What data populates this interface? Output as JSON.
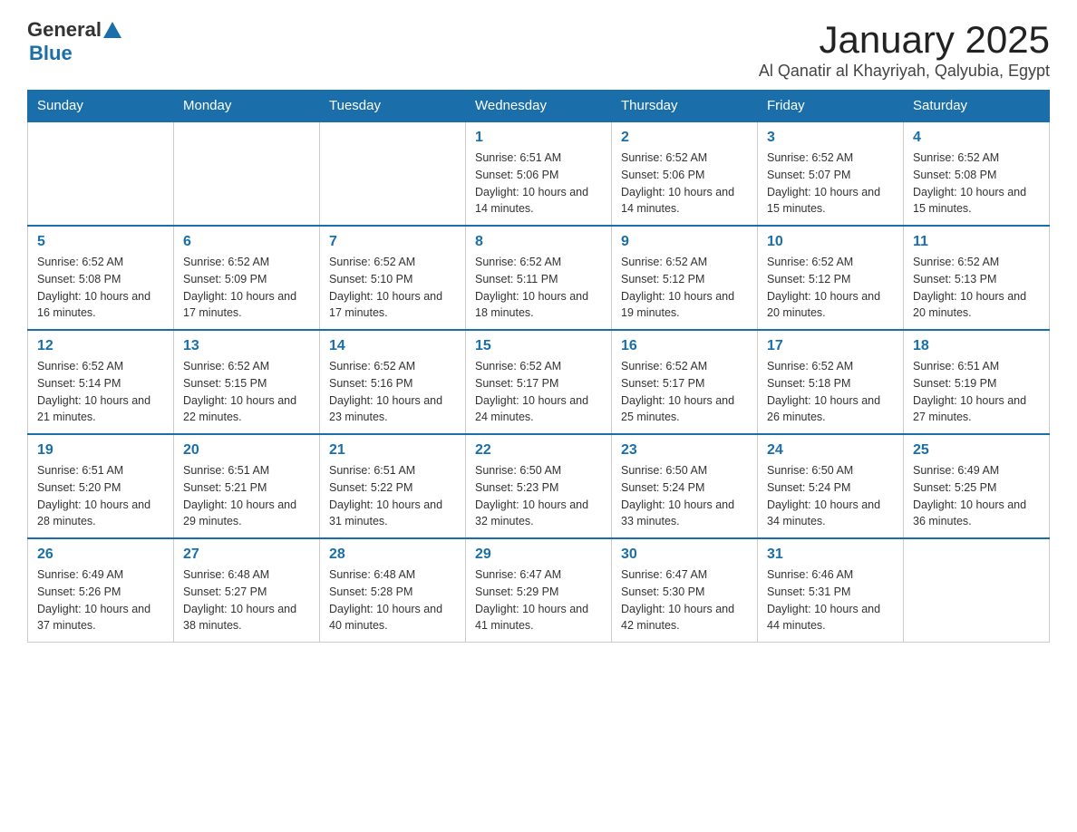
{
  "header": {
    "logo_general": "General",
    "logo_blue": "Blue",
    "month_title": "January 2025",
    "location": "Al Qanatir al Khayriyah, Qalyubia, Egypt"
  },
  "weekdays": [
    "Sunday",
    "Monday",
    "Tuesday",
    "Wednesday",
    "Thursday",
    "Friday",
    "Saturday"
  ],
  "weeks": [
    [
      {
        "day": "",
        "sunrise": "",
        "sunset": "",
        "daylight": ""
      },
      {
        "day": "",
        "sunrise": "",
        "sunset": "",
        "daylight": ""
      },
      {
        "day": "",
        "sunrise": "",
        "sunset": "",
        "daylight": ""
      },
      {
        "day": "1",
        "sunrise": "Sunrise: 6:51 AM",
        "sunset": "Sunset: 5:06 PM",
        "daylight": "Daylight: 10 hours and 14 minutes."
      },
      {
        "day": "2",
        "sunrise": "Sunrise: 6:52 AM",
        "sunset": "Sunset: 5:06 PM",
        "daylight": "Daylight: 10 hours and 14 minutes."
      },
      {
        "day": "3",
        "sunrise": "Sunrise: 6:52 AM",
        "sunset": "Sunset: 5:07 PM",
        "daylight": "Daylight: 10 hours and 15 minutes."
      },
      {
        "day": "4",
        "sunrise": "Sunrise: 6:52 AM",
        "sunset": "Sunset: 5:08 PM",
        "daylight": "Daylight: 10 hours and 15 minutes."
      }
    ],
    [
      {
        "day": "5",
        "sunrise": "Sunrise: 6:52 AM",
        "sunset": "Sunset: 5:08 PM",
        "daylight": "Daylight: 10 hours and 16 minutes."
      },
      {
        "day": "6",
        "sunrise": "Sunrise: 6:52 AM",
        "sunset": "Sunset: 5:09 PM",
        "daylight": "Daylight: 10 hours and 17 minutes."
      },
      {
        "day": "7",
        "sunrise": "Sunrise: 6:52 AM",
        "sunset": "Sunset: 5:10 PM",
        "daylight": "Daylight: 10 hours and 17 minutes."
      },
      {
        "day": "8",
        "sunrise": "Sunrise: 6:52 AM",
        "sunset": "Sunset: 5:11 PM",
        "daylight": "Daylight: 10 hours and 18 minutes."
      },
      {
        "day": "9",
        "sunrise": "Sunrise: 6:52 AM",
        "sunset": "Sunset: 5:12 PM",
        "daylight": "Daylight: 10 hours and 19 minutes."
      },
      {
        "day": "10",
        "sunrise": "Sunrise: 6:52 AM",
        "sunset": "Sunset: 5:12 PM",
        "daylight": "Daylight: 10 hours and 20 minutes."
      },
      {
        "day": "11",
        "sunrise": "Sunrise: 6:52 AM",
        "sunset": "Sunset: 5:13 PM",
        "daylight": "Daylight: 10 hours and 20 minutes."
      }
    ],
    [
      {
        "day": "12",
        "sunrise": "Sunrise: 6:52 AM",
        "sunset": "Sunset: 5:14 PM",
        "daylight": "Daylight: 10 hours and 21 minutes."
      },
      {
        "day": "13",
        "sunrise": "Sunrise: 6:52 AM",
        "sunset": "Sunset: 5:15 PM",
        "daylight": "Daylight: 10 hours and 22 minutes."
      },
      {
        "day": "14",
        "sunrise": "Sunrise: 6:52 AM",
        "sunset": "Sunset: 5:16 PM",
        "daylight": "Daylight: 10 hours and 23 minutes."
      },
      {
        "day": "15",
        "sunrise": "Sunrise: 6:52 AM",
        "sunset": "Sunset: 5:17 PM",
        "daylight": "Daylight: 10 hours and 24 minutes."
      },
      {
        "day": "16",
        "sunrise": "Sunrise: 6:52 AM",
        "sunset": "Sunset: 5:17 PM",
        "daylight": "Daylight: 10 hours and 25 minutes."
      },
      {
        "day": "17",
        "sunrise": "Sunrise: 6:52 AM",
        "sunset": "Sunset: 5:18 PM",
        "daylight": "Daylight: 10 hours and 26 minutes."
      },
      {
        "day": "18",
        "sunrise": "Sunrise: 6:51 AM",
        "sunset": "Sunset: 5:19 PM",
        "daylight": "Daylight: 10 hours and 27 minutes."
      }
    ],
    [
      {
        "day": "19",
        "sunrise": "Sunrise: 6:51 AM",
        "sunset": "Sunset: 5:20 PM",
        "daylight": "Daylight: 10 hours and 28 minutes."
      },
      {
        "day": "20",
        "sunrise": "Sunrise: 6:51 AM",
        "sunset": "Sunset: 5:21 PM",
        "daylight": "Daylight: 10 hours and 29 minutes."
      },
      {
        "day": "21",
        "sunrise": "Sunrise: 6:51 AM",
        "sunset": "Sunset: 5:22 PM",
        "daylight": "Daylight: 10 hours and 31 minutes."
      },
      {
        "day": "22",
        "sunrise": "Sunrise: 6:50 AM",
        "sunset": "Sunset: 5:23 PM",
        "daylight": "Daylight: 10 hours and 32 minutes."
      },
      {
        "day": "23",
        "sunrise": "Sunrise: 6:50 AM",
        "sunset": "Sunset: 5:24 PM",
        "daylight": "Daylight: 10 hours and 33 minutes."
      },
      {
        "day": "24",
        "sunrise": "Sunrise: 6:50 AM",
        "sunset": "Sunset: 5:24 PM",
        "daylight": "Daylight: 10 hours and 34 minutes."
      },
      {
        "day": "25",
        "sunrise": "Sunrise: 6:49 AM",
        "sunset": "Sunset: 5:25 PM",
        "daylight": "Daylight: 10 hours and 36 minutes."
      }
    ],
    [
      {
        "day": "26",
        "sunrise": "Sunrise: 6:49 AM",
        "sunset": "Sunset: 5:26 PM",
        "daylight": "Daylight: 10 hours and 37 minutes."
      },
      {
        "day": "27",
        "sunrise": "Sunrise: 6:48 AM",
        "sunset": "Sunset: 5:27 PM",
        "daylight": "Daylight: 10 hours and 38 minutes."
      },
      {
        "day": "28",
        "sunrise": "Sunrise: 6:48 AM",
        "sunset": "Sunset: 5:28 PM",
        "daylight": "Daylight: 10 hours and 40 minutes."
      },
      {
        "day": "29",
        "sunrise": "Sunrise: 6:47 AM",
        "sunset": "Sunset: 5:29 PM",
        "daylight": "Daylight: 10 hours and 41 minutes."
      },
      {
        "day": "30",
        "sunrise": "Sunrise: 6:47 AM",
        "sunset": "Sunset: 5:30 PM",
        "daylight": "Daylight: 10 hours and 42 minutes."
      },
      {
        "day": "31",
        "sunrise": "Sunrise: 6:46 AM",
        "sunset": "Sunset: 5:31 PM",
        "daylight": "Daylight: 10 hours and 44 minutes."
      },
      {
        "day": "",
        "sunrise": "",
        "sunset": "",
        "daylight": ""
      }
    ]
  ]
}
